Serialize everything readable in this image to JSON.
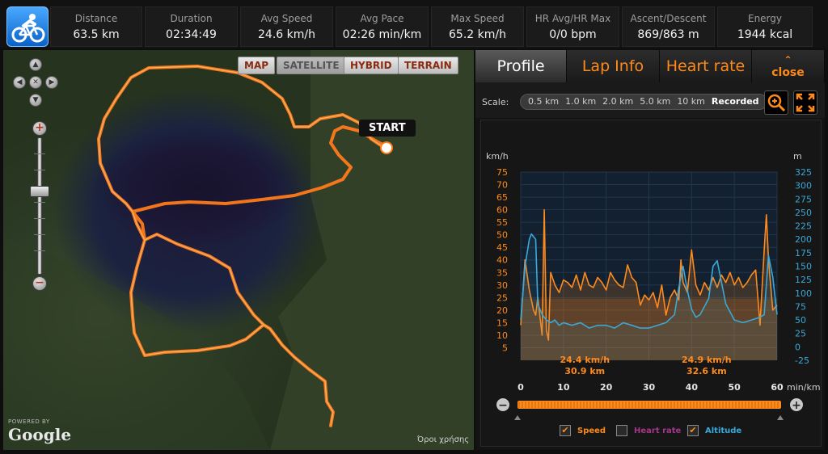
{
  "stats": [
    {
      "label": "Distance",
      "value": "63.5 km"
    },
    {
      "label": "Duration",
      "value": "02:34:49"
    },
    {
      "label": "Avg Speed",
      "value": "24.6 km/h"
    },
    {
      "label": "Avg Pace",
      "value": "02:26 min/km"
    },
    {
      "label": "Max Speed",
      "value": "65.2 km/h"
    },
    {
      "label": "HR Avg/HR Max",
      "value": "0/0 bpm"
    },
    {
      "label": "Ascent/Descent",
      "value": "869/863 m"
    },
    {
      "label": "Energy",
      "value": "1944 kcal"
    }
  ],
  "map": {
    "types": [
      "MAP",
      "SATELLITE",
      "HYBRID",
      "TERRAIN"
    ],
    "start_label": "START",
    "powered_by": "POWERED BY",
    "google": "Google",
    "terms": "Όροι χρήσης"
  },
  "tabs": {
    "profile": "Profile",
    "lap": "Lap Info",
    "hr": "Heart rate",
    "close": "close"
  },
  "scale": {
    "label": "Scale:",
    "options": [
      "0.5 km",
      "1.0 km",
      "2.0 km",
      "5.0 km",
      "10 km",
      "Recorded"
    ],
    "selected": "Recorded"
  },
  "chart_data": {
    "type": "line",
    "xlabel": "min/km",
    "y_left_label": "km/h",
    "y_right_label": "m",
    "x_ticks": [
      0,
      10,
      20,
      30,
      40,
      50,
      60
    ],
    "y_left_ticks": [
      5,
      10,
      15,
      20,
      25,
      30,
      35,
      40,
      45,
      50,
      55,
      60,
      65,
      70,
      75
    ],
    "y_right_ticks": [
      -25,
      0,
      25,
      50,
      75,
      100,
      125,
      150,
      175,
      200,
      225,
      250,
      275,
      300,
      325
    ],
    "xlim": [
      0,
      60
    ],
    "ylim_left": [
      0,
      75
    ],
    "ylim_right": [
      -25,
      325
    ],
    "annotations": [
      {
        "line1": "24.4 km/h",
        "line2": "30.9 km"
      },
      {
        "line1": "24.9 km/h",
        "line2": "32.6 km"
      }
    ],
    "series": [
      {
        "name": "Speed",
        "color": "#ff8a1c",
        "x": [
          0,
          1,
          2,
          3,
          3.5,
          4,
          5,
          5.5,
          6,
          6.5,
          7,
          8,
          9,
          10,
          11,
          12,
          13,
          14,
          15,
          16,
          17,
          18,
          19,
          20,
          21,
          22,
          23,
          24,
          25,
          26,
          27,
          28,
          29,
          30,
          31,
          32,
          33,
          34,
          35,
          36,
          37,
          37.5,
          38,
          39,
          40,
          41,
          42,
          43,
          44,
          45,
          46,
          47,
          48,
          49,
          50,
          51,
          52,
          53,
          54,
          55,
          56,
          57,
          57.5,
          58,
          59,
          60
        ],
        "y": [
          14,
          40,
          28,
          20,
          18,
          25,
          10,
          60,
          12,
          8,
          35,
          30,
          27,
          32,
          31,
          29,
          34,
          28,
          35,
          30,
          29,
          33,
          31,
          28,
          35,
          32,
          30,
          29,
          38,
          33,
          31,
          22,
          26,
          24,
          27,
          21,
          30,
          18,
          25,
          28,
          24,
          40,
          31,
          27,
          44,
          30,
          26,
          31,
          28,
          33,
          29,
          34,
          31,
          35,
          30,
          33,
          29,
          31,
          34,
          36,
          14,
          44,
          58,
          40,
          20,
          22
        ]
      },
      {
        "name": "Altitude",
        "color": "#3aa8d8",
        "x": [
          0,
          1,
          2,
          2.5,
          3,
          3.5,
          4,
          5,
          6,
          7,
          8,
          9,
          10,
          12,
          14,
          16,
          18,
          20,
          22,
          24,
          26,
          28,
          30,
          32,
          34,
          36,
          37,
          38,
          39,
          40,
          41,
          42,
          43,
          44,
          45,
          46,
          47,
          48,
          50,
          52,
          54,
          56,
          57,
          58,
          59,
          60
        ],
        "y": [
          50,
          150,
          200,
          210,
          205,
          200,
          80,
          60,
          50,
          45,
          50,
          40,
          45,
          40,
          45,
          35,
          40,
          40,
          35,
          45,
          40,
          35,
          35,
          40,
          45,
          60,
          110,
          150,
          105,
          70,
          55,
          60,
          75,
          90,
          150,
          160,
          120,
          80,
          50,
          45,
          50,
          55,
          60,
          170,
          130,
          60
        ]
      }
    ],
    "legend": {
      "speed": "Speed",
      "heart_rate": "Heart rate",
      "altitude": "Altitude"
    },
    "grid": true
  }
}
